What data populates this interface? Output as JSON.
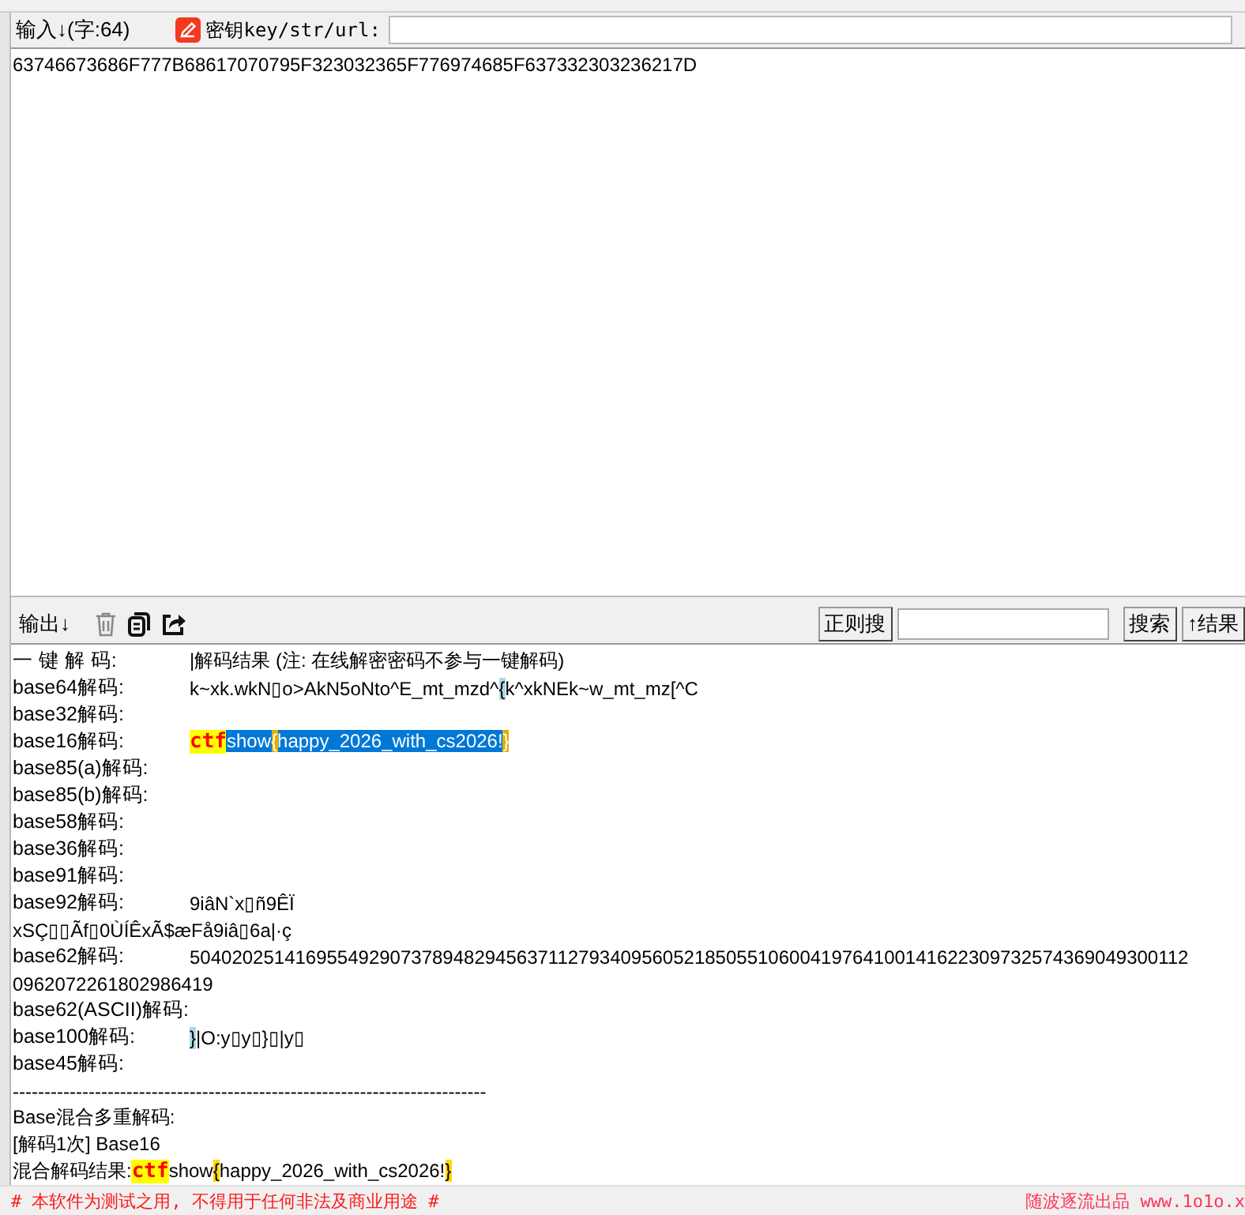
{
  "input_bar": {
    "label": "输入↓(字:64)",
    "key_label": "密钥key/str/url:"
  },
  "input_text": "63746673686F777B68617070795F323032365F776974685F637332303236217D",
  "output_toolbar": {
    "label": "输出↓",
    "regex_button": "正则搜",
    "search_button": "搜索",
    "result_button": "↑结果"
  },
  "output_lines": [
    {
      "kind": "pair",
      "label": "一 键 解 码:",
      "segments": [
        {
          "text": "|解码结果 (注: 在线解密密码不参与一键解码)",
          "kind": "plain",
          "selected": false
        }
      ]
    },
    {
      "kind": "pair",
      "label": "base64解码:",
      "segments": [
        {
          "text": "k~xk.wkN▯o>AkN5oNto^E_mt_mzd^",
          "kind": "plain",
          "selected": false
        },
        {
          "text": "{",
          "kind": "match",
          "selected": false
        },
        {
          "text": "k^xkNEk~w_mt_mz[^C",
          "kind": "plain",
          "selected": false
        }
      ]
    },
    {
      "kind": "pair",
      "label": "base32解码:"
    },
    {
      "kind": "pair",
      "label": "base16解码:",
      "segments": [
        {
          "text": "ctf",
          "kind": "keyword",
          "selected": false
        },
        {
          "text": "show",
          "kind": "plain",
          "selected": true
        },
        {
          "text": "{",
          "kind": "brace",
          "selected": true
        },
        {
          "text": "happy_2026_with_cs2026!",
          "kind": "plain",
          "selected": true
        },
        {
          "text": "}",
          "kind": "brace",
          "selected": true
        }
      ]
    },
    {
      "kind": "pair",
      "label": "base85(a)解码:"
    },
    {
      "kind": "pair",
      "label": "base85(b)解码:"
    },
    {
      "kind": "pair",
      "label": "base58解码:"
    },
    {
      "kind": "pair",
      "label": "base36解码:"
    },
    {
      "kind": "pair",
      "label": "base91解码:"
    },
    {
      "kind": "pair",
      "label": "base92解码:",
      "segments": [
        {
          "text": "9iâN`x▯ñ9ÊÏ",
          "kind": "plain",
          "selected": false
        }
      ]
    },
    {
      "kind": "text",
      "segments": [
        {
          "text": "xSÇ▯▯Ãf▯0ÙÍÊxÃ$æFå9iâ▯6a|·ç",
          "kind": "plain",
          "selected": false
        }
      ]
    },
    {
      "kind": "pair",
      "label": "base62解码:",
      "segments": [
        {
          "text": "50402025141695549290737894829456371127934095605218505510600419764100141622309732574369049300112",
          "kind": "plain",
          "selected": false
        }
      ]
    },
    {
      "kind": "text",
      "segments": [
        {
          "text": "0962072261802986419",
          "kind": "plain",
          "selected": false
        }
      ]
    },
    {
      "kind": "pair",
      "label": "base62(ASCII)解码:"
    },
    {
      "kind": "pair",
      "label": "base100解码:",
      "segments": [
        {
          "text": "}",
          "kind": "match",
          "selected": false
        },
        {
          "text": "|O:y▯y▯}▯|y▯",
          "kind": "plain",
          "selected": false
        }
      ]
    },
    {
      "kind": "pair",
      "label": "base45解码:"
    },
    {
      "kind": "text",
      "segments": [
        {
          "text": "---------------------------------------------------------------------------",
          "kind": "plain",
          "selected": false
        }
      ]
    },
    {
      "kind": "text",
      "segments": [
        {
          "text": "Base混合多重解码:",
          "kind": "plain",
          "selected": false
        }
      ]
    },
    {
      "kind": "text",
      "segments": [
        {
          "text": "[解码1次] Base16",
          "kind": "plain",
          "selected": false
        }
      ]
    },
    {
      "kind": "text",
      "segments": [
        {
          "text": "混合解码结果:",
          "kind": "plain",
          "selected": false
        },
        {
          "text": "ctf",
          "kind": "keyword",
          "selected": false
        },
        {
          "text": "show",
          "kind": "plain",
          "selected": false
        },
        {
          "text": "{",
          "kind": "brace",
          "selected": false
        },
        {
          "text": "happy_2026_with_cs2026!",
          "kind": "plain",
          "selected": false
        },
        {
          "text": "}",
          "kind": "brace",
          "selected": false
        }
      ]
    }
  ],
  "footer": {
    "notice": "# 本软件为测试之用, 不得用于任何非法及商业用途 #",
    "credit": "随波逐流出品 www.1o1o.x"
  }
}
